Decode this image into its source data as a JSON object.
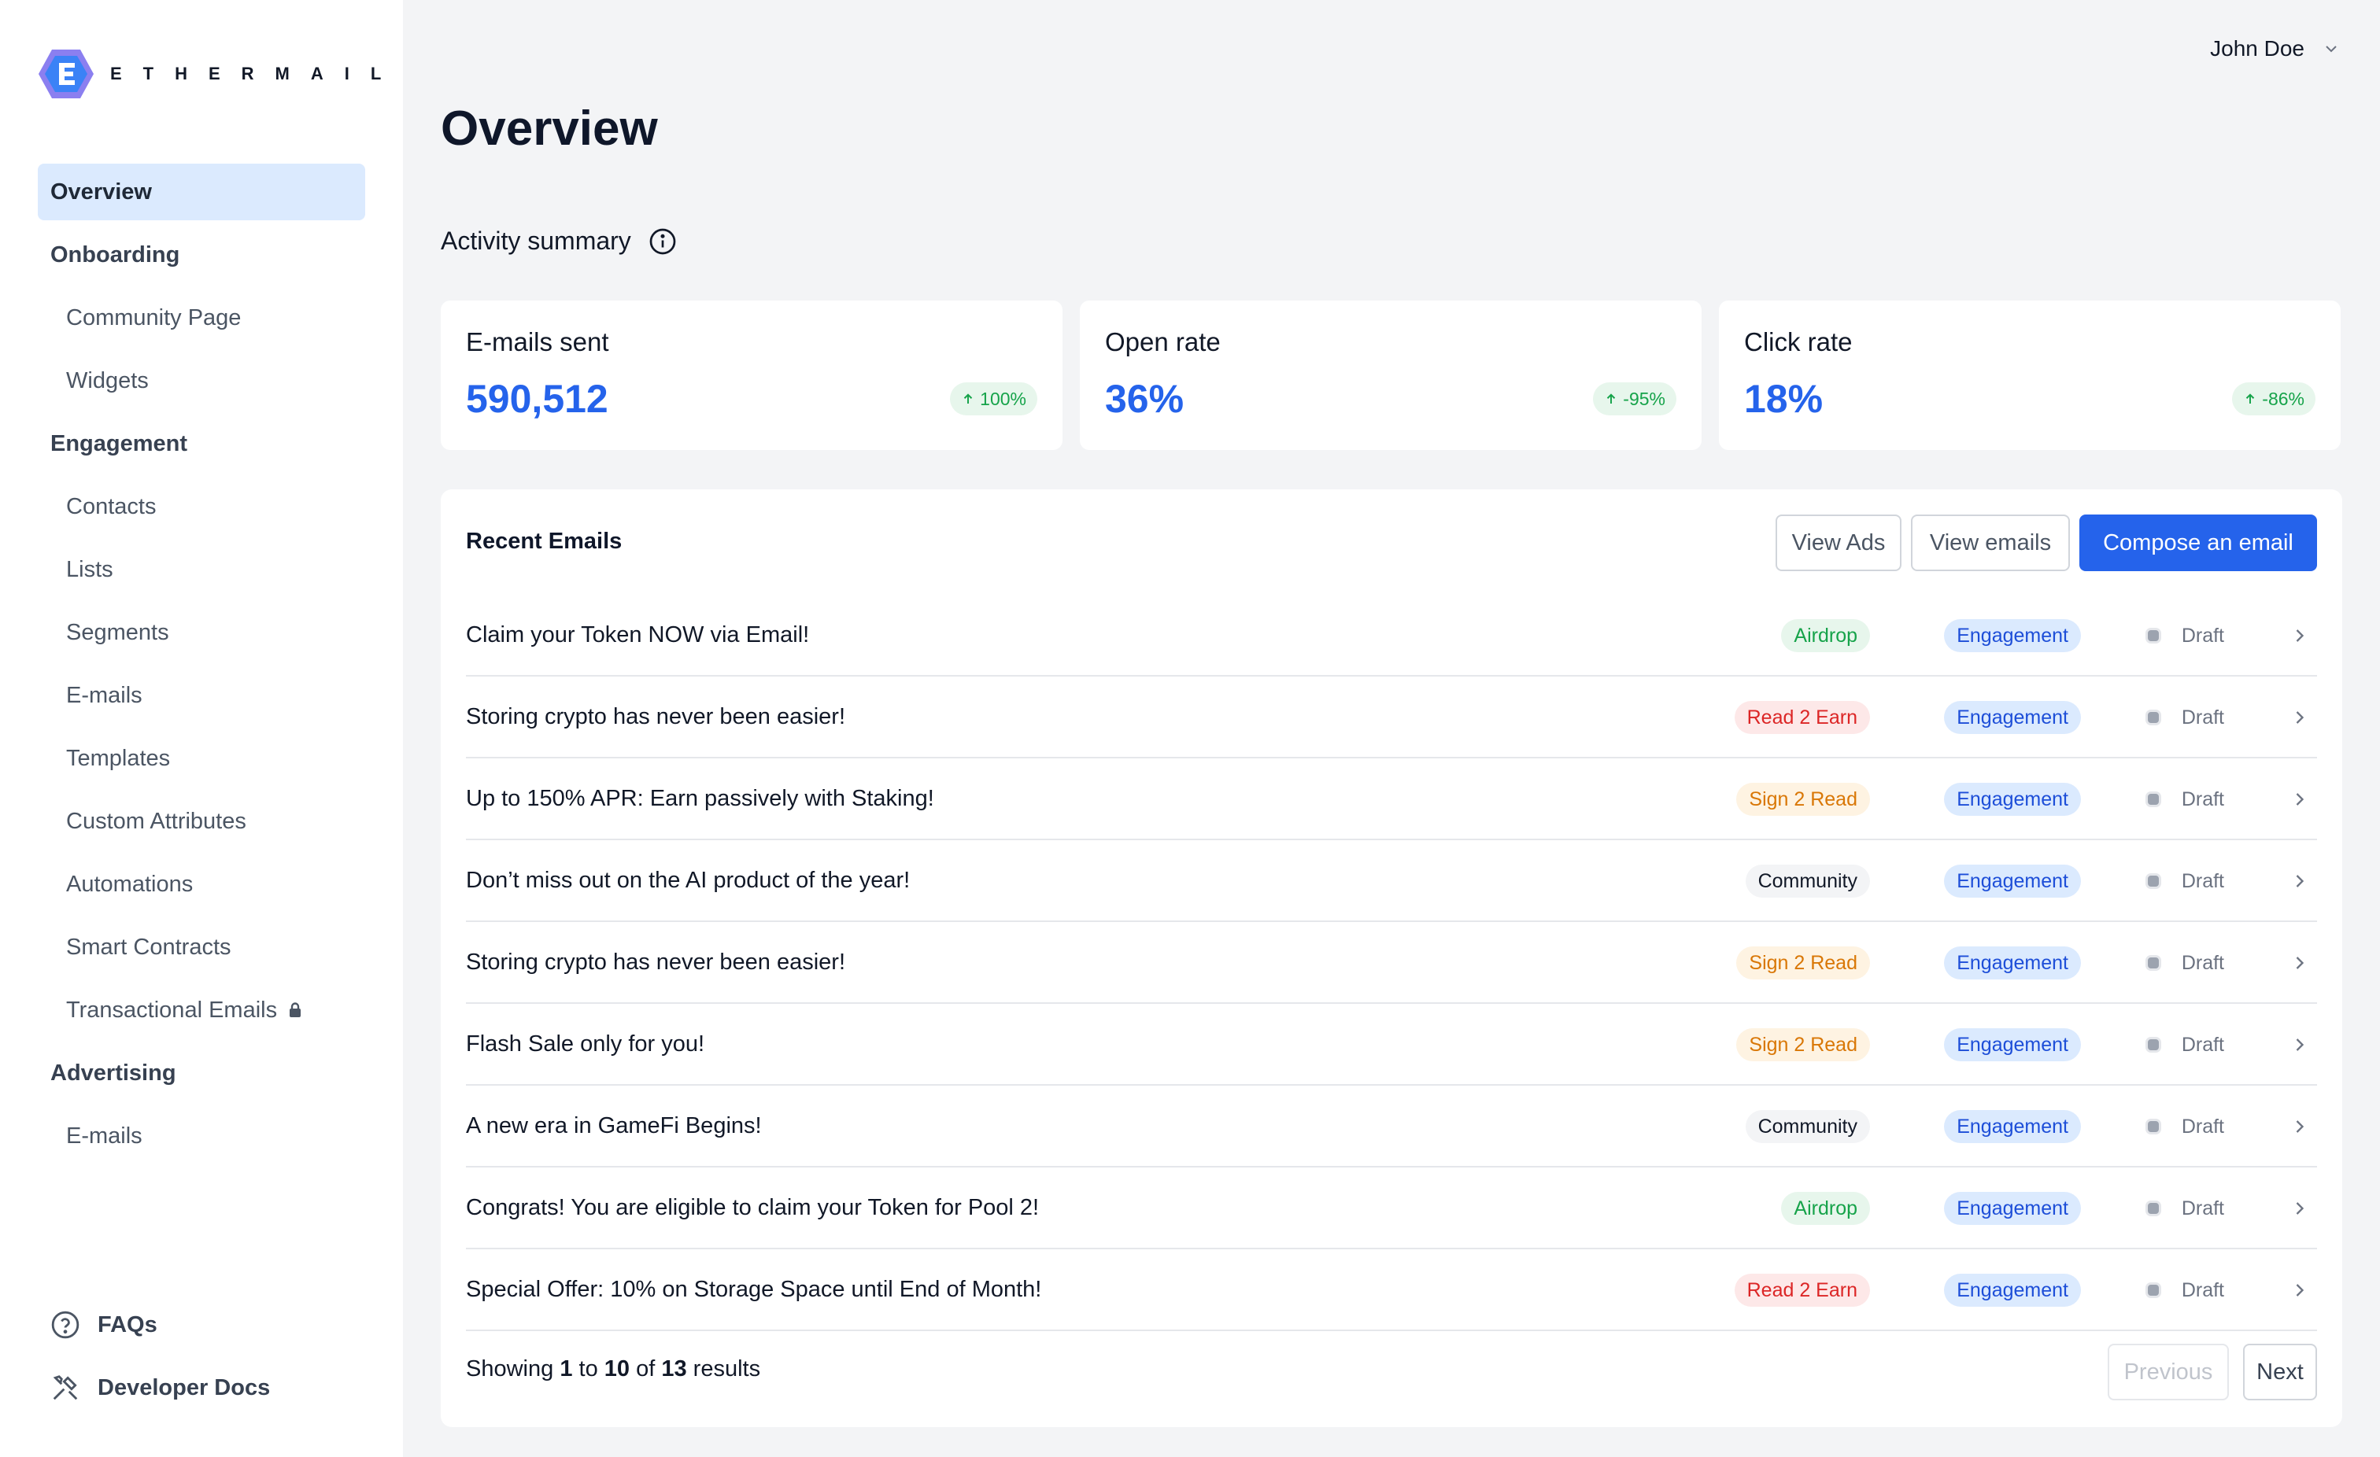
{
  "brand": {
    "name": "ETHERMAIL"
  },
  "user": {
    "name": "John Doe"
  },
  "sidebar": {
    "items": [
      {
        "label": "Overview",
        "kind": "section",
        "active": true
      },
      {
        "label": "Onboarding",
        "kind": "section"
      },
      {
        "label": "Community Page",
        "kind": "sub"
      },
      {
        "label": "Widgets",
        "kind": "sub"
      },
      {
        "label": "Engagement",
        "kind": "section"
      },
      {
        "label": "Contacts",
        "kind": "sub"
      },
      {
        "label": "Lists",
        "kind": "sub"
      },
      {
        "label": "Segments",
        "kind": "sub"
      },
      {
        "label": "E-mails",
        "kind": "sub"
      },
      {
        "label": "Templates",
        "kind": "sub"
      },
      {
        "label": "Custom Attributes",
        "kind": "sub"
      },
      {
        "label": "Automations",
        "kind": "sub"
      },
      {
        "label": "Smart Contracts",
        "kind": "sub"
      },
      {
        "label": "Transactional Emails",
        "kind": "sub",
        "locked": true
      },
      {
        "label": "Advertising",
        "kind": "section"
      },
      {
        "label": "E-mails",
        "kind": "sub"
      }
    ],
    "bottom": [
      {
        "label": "FAQs",
        "icon": "question-circle-icon"
      },
      {
        "label": "Developer Docs",
        "icon": "tools-icon"
      }
    ]
  },
  "page": {
    "title": "Overview",
    "section_title": "Activity summary"
  },
  "stats": [
    {
      "label": "E-mails sent",
      "value": "590,512",
      "trend": "100%"
    },
    {
      "label": "Open rate",
      "value": "36%",
      "trend": "-95%"
    },
    {
      "label": "Click rate",
      "value": "18%",
      "trend": "-86%"
    }
  ],
  "recent": {
    "title": "Recent Emails",
    "buttons": {
      "view_ads": "View Ads",
      "view_emails": "View emails",
      "compose": "Compose an email"
    },
    "rows": [
      {
        "title": "Claim your Token NOW via Email!",
        "type": "Airdrop",
        "category": "Engagement",
        "status": "Draft"
      },
      {
        "title": "Storing crypto has never been easier!",
        "type": "Read 2 Earn",
        "category": "Engagement",
        "status": "Draft"
      },
      {
        "title": "Up to 150% APR: Earn passively with Staking!",
        "type": "Sign 2 Read",
        "category": "Engagement",
        "status": "Draft"
      },
      {
        "title": "Don’t miss out on the AI product of the year!",
        "type": "Community",
        "category": "Engagement",
        "status": "Draft"
      },
      {
        "title": "Storing crypto has never been easier!",
        "type": "Sign 2 Read",
        "category": "Engagement",
        "status": "Draft"
      },
      {
        "title": "Flash Sale only for you!",
        "type": "Sign 2 Read",
        "category": "Engagement",
        "status": "Draft"
      },
      {
        "title": "A new era in GameFi Begins!",
        "type": "Community",
        "category": "Engagement",
        "status": "Draft"
      },
      {
        "title": "Congrats! You are eligible to claim your Token for Pool 2!",
        "type": "Airdrop",
        "category": "Engagement",
        "status": "Draft"
      },
      {
        "title": "Special Offer: 10% on Storage Space until End of Month!",
        "type": "Read 2 Earn",
        "category": "Engagement",
        "status": "Draft"
      }
    ],
    "pagination": {
      "showing": "Showing",
      "from": "1",
      "to_word": "to",
      "to": "10",
      "of_word": "of",
      "total": "13",
      "results": "results",
      "previous": "Previous",
      "next": "Next"
    }
  },
  "tag_colors": {
    "Airdrop": {
      "bg": "#e7f6ec",
      "fg": "#16a34a"
    },
    "Read 2 Earn": {
      "bg": "#fde8e8",
      "fg": "#dc2626"
    },
    "Sign 2 Read": {
      "bg": "#fef3e2",
      "fg": "#d97706"
    },
    "Community": {
      "bg": "#f3f4f6",
      "fg": "#111827"
    }
  },
  "colors": {
    "accent": "#2563eb",
    "active_nav": "#dbeafe"
  }
}
